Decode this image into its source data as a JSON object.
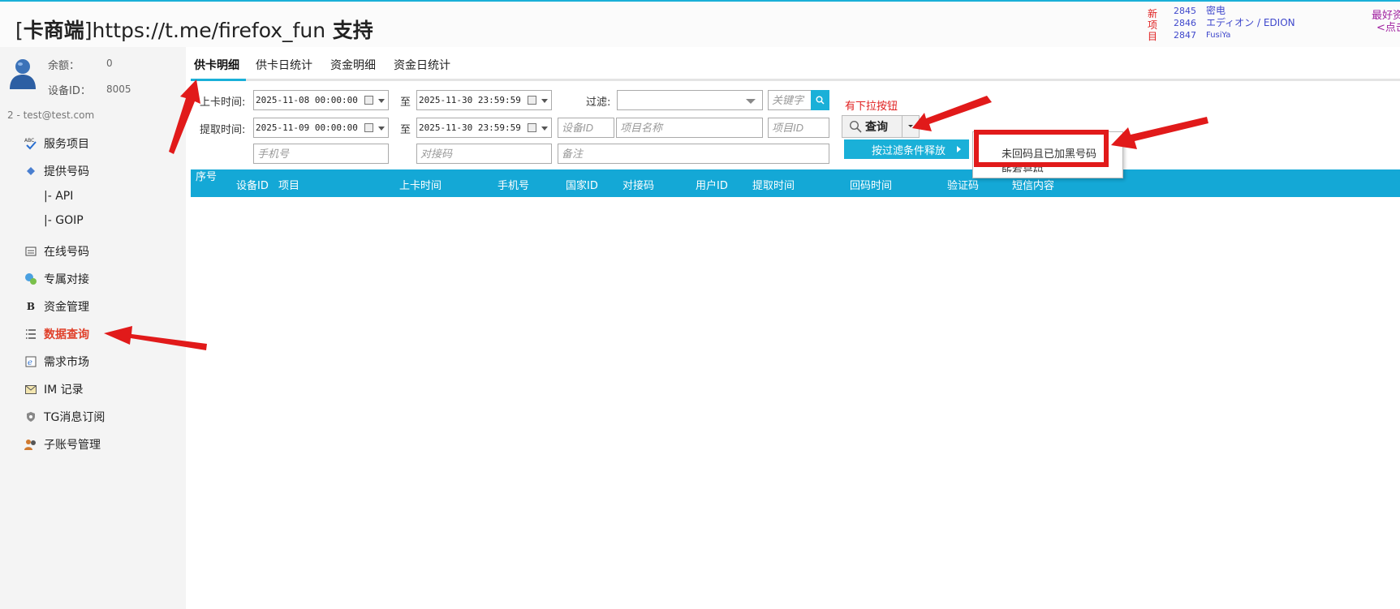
{
  "header": {
    "title_bracket_open": "[",
    "title_brand": "卡商端",
    "title_bracket_close": "]",
    "title_url": "https://t.me/firefox_fun",
    "title_support": " 支持",
    "new_projects_label": "新项目",
    "new_projects": [
      {
        "id": "2845",
        "name": "密电"
      },
      {
        "id": "2846",
        "name": "エディオン / EDION"
      },
      {
        "id": "2847",
        "name": "FusiYa"
      }
    ],
    "right_note_line1": "最好资",
    "right_note_line2": "<点击"
  },
  "account": {
    "balance_label": "余额：",
    "balance_value": "0",
    "device_label": "设备ID：",
    "device_value": "8005",
    "email": "2 - test@test.com"
  },
  "sidebar": {
    "items": [
      {
        "label": "服务项目",
        "icon": "abc-check-icon"
      },
      {
        "label": "提供号码",
        "icon": "diamond-icon"
      },
      {
        "label": "|-  API"
      },
      {
        "label": "|-  GOIP"
      },
      {
        "label": "在线号码",
        "icon": "window-icon"
      },
      {
        "label": "专属对接",
        "icon": "globe-people-icon"
      },
      {
        "label": "资金管理",
        "icon": "bold-b-icon"
      },
      {
        "label": "数据查询",
        "icon": "list-icon"
      },
      {
        "label": "需求市场",
        "icon": "ie-icon"
      },
      {
        "label": "IM 记录",
        "icon": "envelope-icon"
      },
      {
        "label": "TG消息订阅",
        "icon": "shield-icon"
      },
      {
        "label": "子账号管理",
        "icon": "users-icon"
      }
    ]
  },
  "tabs": [
    {
      "label": "供卡明细",
      "active": true
    },
    {
      "label": "供卡日统计"
    },
    {
      "label": "资金明细"
    },
    {
      "label": "资金日统计"
    }
  ],
  "filters": {
    "upload_time_label": "上卡时间:",
    "upload_from": "2025-11-08 00:00:00",
    "to_label": "至",
    "upload_to": "2025-11-30 23:59:59",
    "fetch_time_label": "提取时间:",
    "fetch_from": "2025-11-09 00:00:00",
    "fetch_to": "2025-11-30 23:59:59",
    "filter_label": "过滤:",
    "keyword_placeholder": "关键字",
    "device_id_placeholder": "设备ID",
    "project_name_placeholder": "项目名称",
    "project_id_placeholder": "项目ID",
    "phone_placeholder": "手机号",
    "dock_code_placeholder": "对接码",
    "remark_placeholder": "备注"
  },
  "query": {
    "button_label": "查询",
    "dropdown_note": "有下拉按钮",
    "menu_item": "按过滤条件释放",
    "submenu_items": [
      "未回码且已加黑号码",
      "所有号码"
    ]
  },
  "grid": {
    "columns": [
      "序号",
      "设备ID",
      "项目",
      "上卡时间",
      "手机号",
      "国家ID",
      "对接码",
      "用户ID",
      "提取时间",
      "回码时间",
      "验证码",
      "短信内容"
    ]
  },
  "colors": {
    "accent": "#14a8d6",
    "annotation_red": "#e11a1a",
    "active_nav": "#e0402a"
  }
}
